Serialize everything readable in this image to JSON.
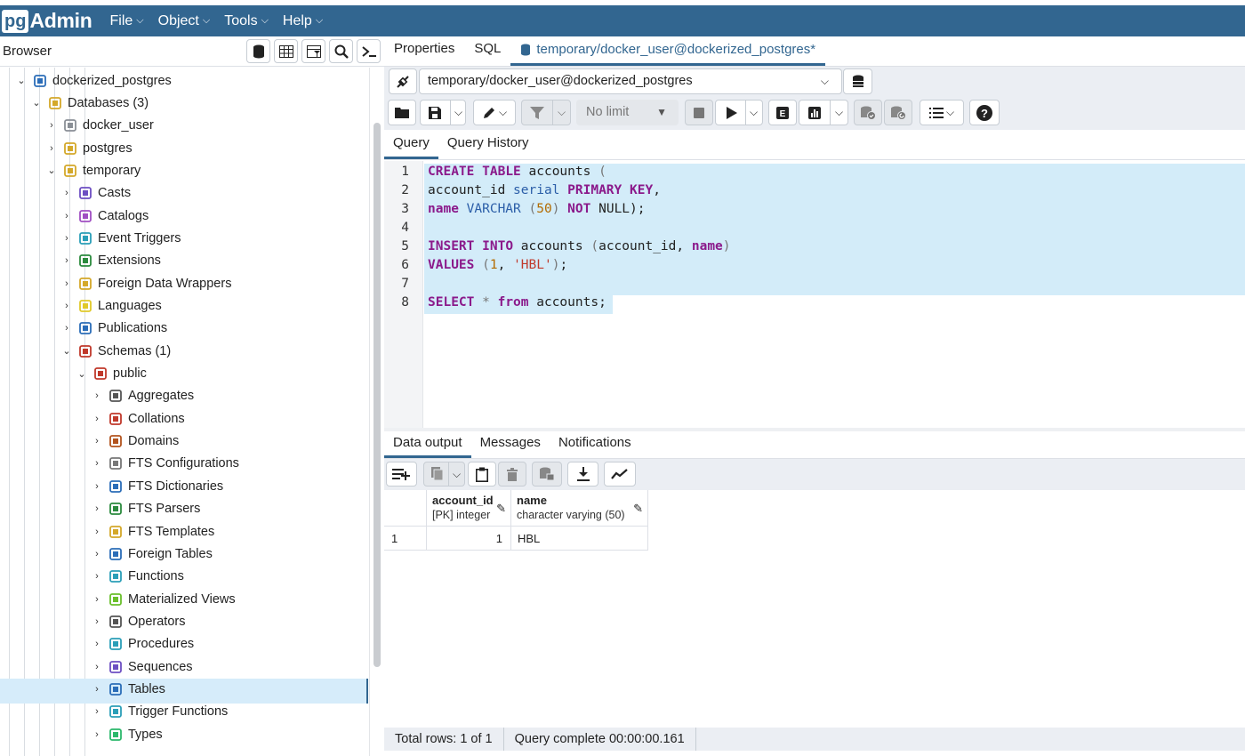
{
  "app": {
    "logo_pg": "pg",
    "logo_admin": "Admin"
  },
  "menu": [
    "File",
    "Object",
    "Tools",
    "Help"
  ],
  "browser": {
    "title": "Browser",
    "tools": [
      "database-icon",
      "table-icon",
      "filter-table-icon",
      "search-icon",
      "terminal-icon"
    ],
    "tree": [
      {
        "label": "dockerized_postgres",
        "arrow": "⌄",
        "icon": "server-icon",
        "color": "#2b6db8"
      },
      {
        "label": "Databases (3)",
        "arrow": "⌄",
        "icon": "databases-icon",
        "color": "#d4a82a"
      },
      {
        "label": "docker_user",
        "arrow": "›",
        "icon": "database-disconnected-icon",
        "color": "#8a8f96"
      },
      {
        "label": "postgres",
        "arrow": "›",
        "icon": "database-icon",
        "color": "#d4a82a"
      },
      {
        "label": "temporary",
        "arrow": "⌄",
        "icon": "database-icon",
        "color": "#d4a82a"
      },
      {
        "label": "Casts",
        "arrow": "›",
        "icon": "casts-icon",
        "color": "#6d4fc2"
      },
      {
        "label": "Catalogs",
        "arrow": "›",
        "icon": "catalogs-icon",
        "color": "#a04fc2"
      },
      {
        "label": "Event Triggers",
        "arrow": "›",
        "icon": "event-triggers-icon",
        "color": "#2b9fb8"
      },
      {
        "label": "Extensions",
        "arrow": "›",
        "icon": "extensions-icon",
        "color": "#2b8a3e"
      },
      {
        "label": "Foreign Data Wrappers",
        "arrow": "›",
        "icon": "fdw-icon",
        "color": "#d4a82a"
      },
      {
        "label": "Languages",
        "arrow": "›",
        "icon": "languages-icon",
        "color": "#e0c92a"
      },
      {
        "label": "Publications",
        "arrow": "›",
        "icon": "publications-icon",
        "color": "#2b6db8"
      },
      {
        "label": "Schemas (1)",
        "arrow": "⌄",
        "icon": "schemas-icon",
        "color": "#c0392b"
      },
      {
        "label": "public",
        "arrow": "⌄",
        "icon": "schema-icon",
        "color": "#c0392b"
      },
      {
        "label": "Aggregates",
        "arrow": "›",
        "icon": "aggregates-icon",
        "color": "#555"
      },
      {
        "label": "Collations",
        "arrow": "›",
        "icon": "collations-icon",
        "color": "#c0392b"
      },
      {
        "label": "Domains",
        "arrow": "›",
        "icon": "domains-icon",
        "color": "#b3541e"
      },
      {
        "label": "FTS Configurations",
        "arrow": "›",
        "icon": "fts-configurations-icon",
        "color": "#777"
      },
      {
        "label": "FTS Dictionaries",
        "arrow": "›",
        "icon": "fts-dictionaries-icon",
        "color": "#2b6db8"
      },
      {
        "label": "FTS Parsers",
        "arrow": "›",
        "icon": "fts-parsers-icon",
        "color": "#2b8a3e"
      },
      {
        "label": "FTS Templates",
        "arrow": "›",
        "icon": "fts-templates-icon",
        "color": "#d4a82a"
      },
      {
        "label": "Foreign Tables",
        "arrow": "›",
        "icon": "foreign-tables-icon",
        "color": "#2b6db8"
      },
      {
        "label": "Functions",
        "arrow": "›",
        "icon": "functions-icon",
        "color": "#2b9fb8"
      },
      {
        "label": "Materialized Views",
        "arrow": "›",
        "icon": "materialized-views-icon",
        "color": "#6abf2b"
      },
      {
        "label": "Operators",
        "arrow": "›",
        "icon": "operators-icon",
        "color": "#555"
      },
      {
        "label": "Procedures",
        "arrow": "›",
        "icon": "procedures-icon",
        "color": "#2b9fb8"
      },
      {
        "label": "Sequences",
        "arrow": "›",
        "icon": "sequences-icon",
        "color": "#6d4fc2"
      },
      {
        "label": "Tables",
        "arrow": "›",
        "icon": "tables-icon",
        "color": "#2b6db8"
      },
      {
        "label": "Trigger Functions",
        "arrow": "›",
        "icon": "trigger-functions-icon",
        "color": "#2b9fb8"
      },
      {
        "label": "Types",
        "arrow": "›",
        "icon": "types-icon",
        "color": "#2bb86b"
      }
    ]
  },
  "tabs": [
    "Properties",
    "SQL",
    "temporary/docker_user@dockerized_postgres*"
  ],
  "connection": "temporary/docker_user@dockerized_postgres",
  "toolbar": {
    "limit": "No limit"
  },
  "query_tabs": [
    "Query",
    "Query History"
  ],
  "editor": {
    "line_numbers": [
      "1",
      "2",
      "3",
      "4",
      "5",
      "6",
      "7",
      "8"
    ]
  },
  "output_tabs": [
    "Data output",
    "Messages",
    "Notifications"
  ],
  "result": {
    "columns": [
      {
        "name": "account_id",
        "type": "[PK] integer"
      },
      {
        "name": "name",
        "type": "character varying (50)"
      }
    ],
    "rows": [
      {
        "num": "1",
        "account_id": "1",
        "name": "HBL"
      }
    ]
  },
  "status": {
    "rows": "Total rows: 1 of 1",
    "time": "Query complete 00:00:00.161"
  }
}
